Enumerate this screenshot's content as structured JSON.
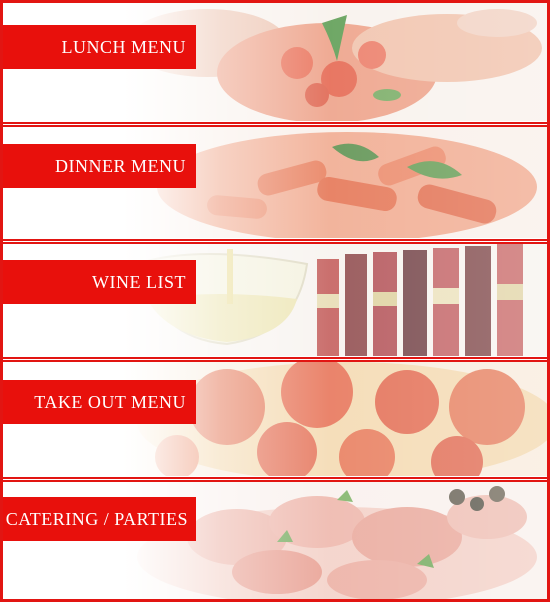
{
  "menu": {
    "items": [
      {
        "label": "LUNCH MENU",
        "photo": "bruschetta-photo"
      },
      {
        "label": "DINNER MENU",
        "photo": "pasta-photo"
      },
      {
        "label": "WINE LIST",
        "photo": "wine-photo"
      },
      {
        "label": "TAKE OUT MENU",
        "photo": "pizza-photo"
      },
      {
        "label": "CATERING / PARTIES",
        "photo": "antipasto-photo"
      }
    ]
  },
  "colors": {
    "accent": "#e8100c",
    "border": "#e21512"
  }
}
